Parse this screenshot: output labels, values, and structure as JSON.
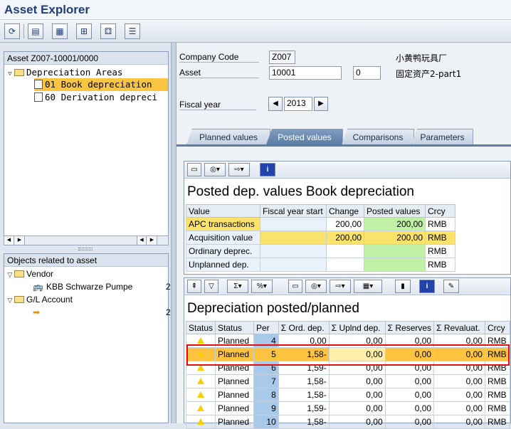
{
  "app": {
    "title": "Asset Explorer"
  },
  "toolbar": {
    "buttons": [
      {
        "name": "refresh-icon"
      },
      {
        "name": "display-change-icon"
      },
      {
        "name": "worklist-icon"
      },
      {
        "name": "asset-structure-icon"
      },
      {
        "name": "simulation-icon"
      },
      {
        "name": "info-list-icon"
      }
    ]
  },
  "tree": {
    "header": "Asset Z007-10001/0000",
    "items": [
      {
        "label": "Depreciation Areas"
      },
      {
        "label": "01 Book depreciation"
      },
      {
        "label": "60 Derivation depreci"
      }
    ]
  },
  "related": {
    "header": "Objects related to asset",
    "items": [
      {
        "label": "Vendor"
      },
      {
        "label": "KBB Schwarze Pumpe",
        "suffix": "2"
      },
      {
        "label": "G/L Account"
      },
      {
        "label": "",
        "suffix": "2"
      }
    ]
  },
  "header_fields": {
    "company_code_label": "Company Code",
    "company_code_value": "Z007",
    "company_name": "小黄鸭玩具厂",
    "asset_label": "Asset",
    "asset_value": "10001",
    "asset_sub": "0",
    "asset_desc": "固定资产2-part1",
    "fiscal_year_label": "Fiscal year",
    "fiscal_year_value": "2013"
  },
  "tabs": [
    {
      "label": "Planned values",
      "active": false
    },
    {
      "label": "Posted values",
      "active": true
    },
    {
      "label": "Comparisons",
      "active": false
    },
    {
      "label": "Parameters",
      "active": false
    }
  ],
  "posted": {
    "title": "Posted dep. values Book depreciation",
    "columns": [
      "Value",
      "Fiscal year start",
      "Change",
      "Posted values",
      "Crcy"
    ],
    "rows": [
      {
        "value": "APC transactions",
        "start": "",
        "change": "200,00",
        "posted": "200,00",
        "crcy": "RMB"
      },
      {
        "value": "Acquisition value",
        "start": "",
        "change": "200,00",
        "posted": "200,00",
        "crcy": "RMB"
      },
      {
        "value": "Ordinary deprec.",
        "start": "",
        "change": "",
        "posted": "",
        "crcy": "RMB"
      },
      {
        "value": "Unplanned dep.",
        "start": "",
        "change": "",
        "posted": "",
        "crcy": "RMB"
      }
    ]
  },
  "depr": {
    "title": "Depreciation posted/planned",
    "columns": [
      "Status",
      "Status",
      "Per",
      "Σ Ord. dep.",
      "Σ Uplnd dep.",
      "Σ Reserves",
      "Σ Revaluat.",
      "Crcy"
    ],
    "rows": [
      {
        "status": "Planned",
        "per": "4",
        "ord": "0,00",
        "upl": "0,00",
        "res": "0,00",
        "rev": "0,00",
        "crcy": "RMB"
      },
      {
        "status": "Planned",
        "per": "5",
        "ord": "1,58-",
        "upl": "0,00",
        "res": "0,00",
        "rev": "0,00",
        "crcy": "RMB"
      },
      {
        "status": "Planned",
        "per": "6",
        "ord": "1,59-",
        "upl": "0,00",
        "res": "0,00",
        "rev": "0,00",
        "crcy": "RMB"
      },
      {
        "status": "Planned",
        "per": "7",
        "ord": "1,58-",
        "upl": "0,00",
        "res": "0,00",
        "rev": "0,00",
        "crcy": "RMB"
      },
      {
        "status": "Planned",
        "per": "8",
        "ord": "1,58-",
        "upl": "0,00",
        "res": "0,00",
        "rev": "0,00",
        "crcy": "RMB"
      },
      {
        "status": "Planned",
        "per": "9",
        "ord": "1,59-",
        "upl": "0,00",
        "res": "0,00",
        "rev": "0,00",
        "crcy": "RMB"
      },
      {
        "status": "Planned",
        "per": "10",
        "ord": "1,58-",
        "upl": "0,00",
        "res": "0,00",
        "rev": "0,00",
        "crcy": "RMB"
      }
    ]
  }
}
